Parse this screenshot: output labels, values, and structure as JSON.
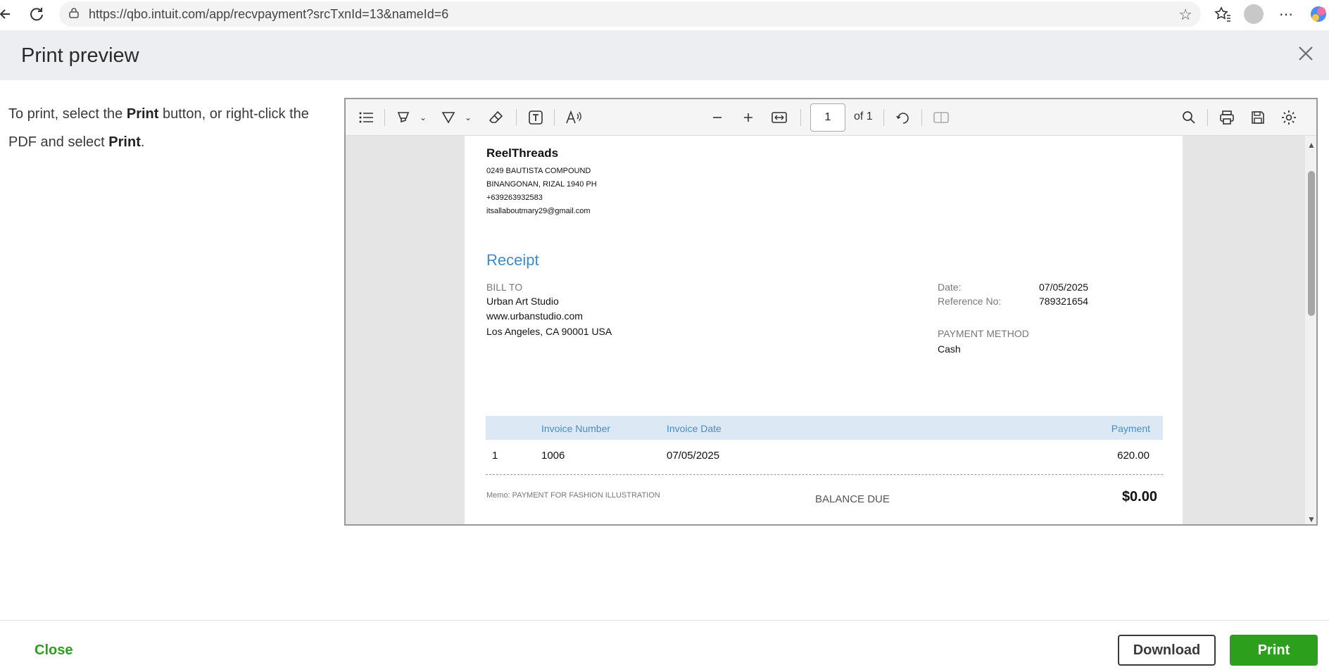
{
  "browser": {
    "url": "https://qbo.intuit.com/app/recvpayment?srcTxnId=13&nameId=6"
  },
  "header": {
    "title": "Print preview"
  },
  "instructions": {
    "part1": "To print, select the ",
    "bold1": "Print",
    "part2": " button, or right-click the PDF and select ",
    "bold2": "Print",
    "part3": "."
  },
  "pdf_toolbar": {
    "page_number": "1",
    "page_of": "of 1"
  },
  "receipt": {
    "company": {
      "name": "ReelThreads",
      "address1": "0249 BAUTISTA COMPOUND",
      "address2": "BINANGONAN, RIZAL  1940 PH",
      "phone": "+639263932583",
      "email": "itsallaboutmary29@gmail.com"
    },
    "title": "Receipt",
    "bill_to": {
      "label": "BILL TO",
      "name": "Urban Art Studio",
      "website": "www.urbanstudio.com",
      "address": "Los Angeles, CA  90001 USA"
    },
    "date_label": "Date:",
    "date_value": "07/05/2025",
    "ref_label": "Reference No:",
    "ref_value": "789321654",
    "payment_method_label": "PAYMENT METHOD",
    "payment_method_value": "Cash",
    "table": {
      "headers": [
        "Invoice Number",
        "Invoice Date",
        "Payment"
      ],
      "rows": [
        {
          "index": "1",
          "invoice_number": "1006",
          "invoice_date": "07/05/2025",
          "payment": "620.00"
        }
      ]
    },
    "memo": "Memo: PAYMENT FOR FASHION ILLUSTRATION",
    "balance_due_label": "BALANCE DUE",
    "balance_due_value": "$0.00"
  },
  "footer": {
    "close_label": "Close",
    "download_label": "Download",
    "print_label": "Print"
  },
  "colors": {
    "accent_green": "#2ca01c",
    "receipt_blue": "#3f8bc5",
    "table_header_bg": "#dce9f4"
  }
}
